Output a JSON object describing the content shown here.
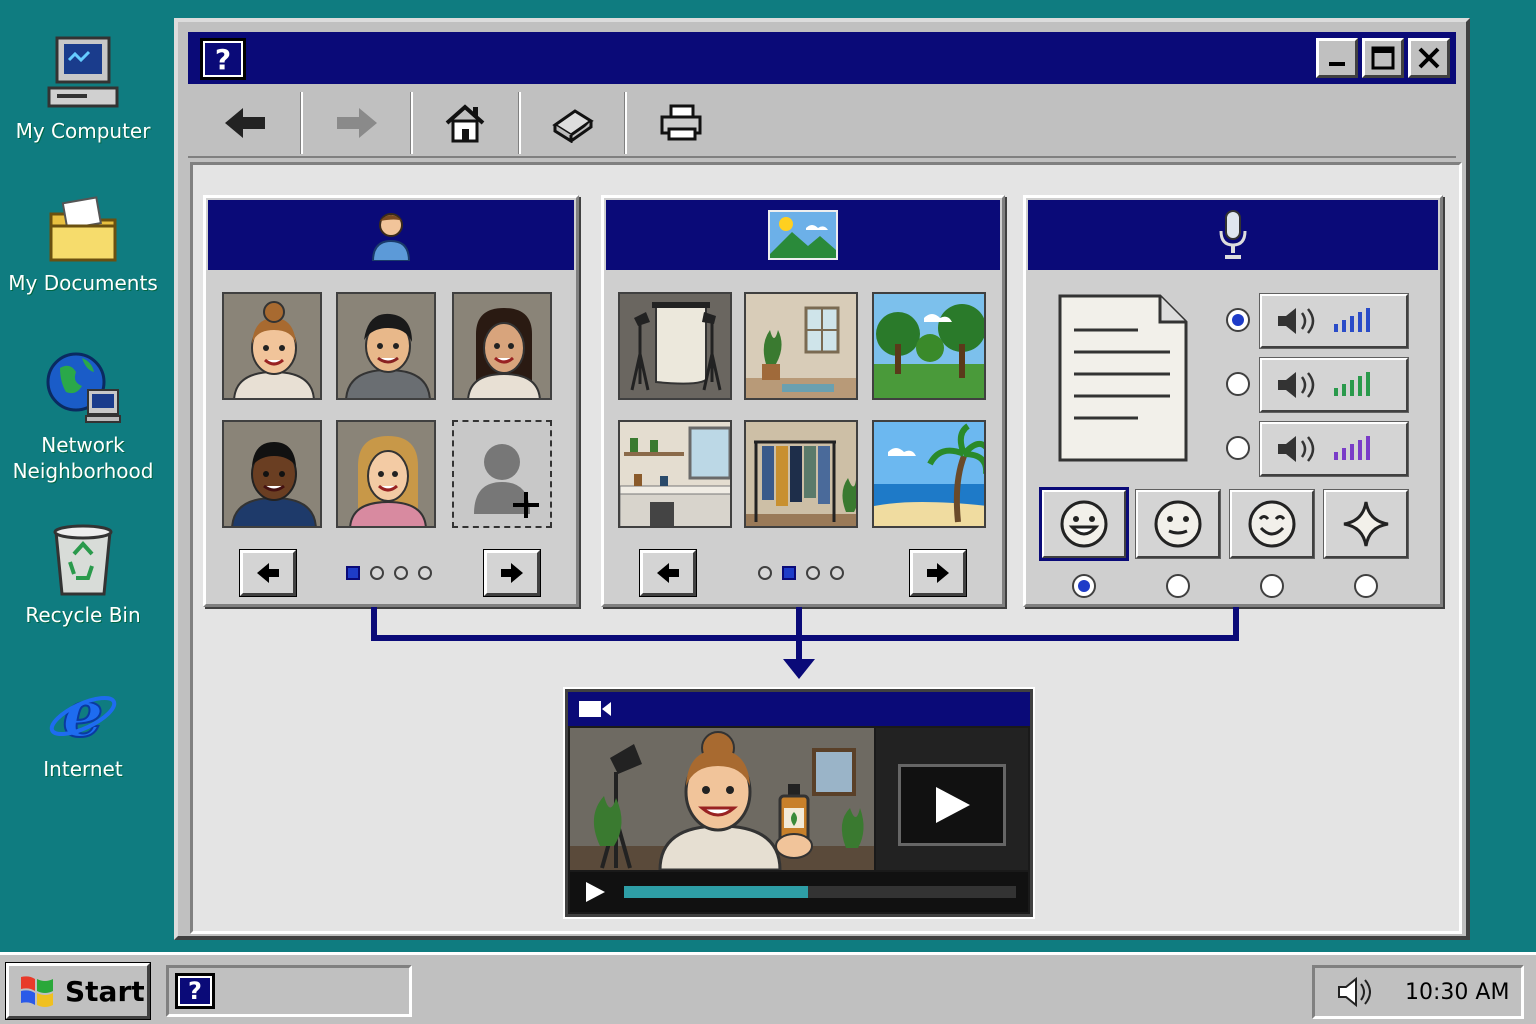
{
  "desktop": {
    "icons": [
      {
        "label": "My Computer",
        "icon": "computer-icon"
      },
      {
        "label": "My Documents",
        "icon": "folder-icon"
      },
      {
        "label": "Network Neighborhood",
        "icon": "network-icon"
      },
      {
        "label": "Recycle Bin",
        "icon": "recycle-bin-icon"
      },
      {
        "label": "Internet",
        "icon": "internet-explorer-icon"
      }
    ]
  },
  "window": {
    "title_icon": "help-icon",
    "help_glyph": "?",
    "toolbar": [
      "back-arrow-icon",
      "forward-arrow-icon",
      "home-icon",
      "book-icon",
      "printer-icon"
    ]
  },
  "avatars_panel": {
    "header_icon": "person-icon",
    "page_dots": 4,
    "active_dot": 1
  },
  "backgrounds_panel": {
    "header_icon": "landscape-icon",
    "page_dots": 4,
    "active_dot": 2
  },
  "voice_panel": {
    "header_icon": "microphone-icon",
    "voices": [
      {
        "selected": true,
        "bar_color": "#2a4cc8"
      },
      {
        "selected": false,
        "bar_color": "#2a9a4c"
      },
      {
        "selected": false,
        "bar_color": "#7a3cc8"
      }
    ],
    "emotions": [
      {
        "icon": "happy-face-icon",
        "selected": true
      },
      {
        "icon": "neutral-face-icon",
        "selected": false
      },
      {
        "icon": "smile-face-icon",
        "selected": false
      },
      {
        "icon": "sparkle-icon",
        "selected": false
      }
    ]
  },
  "video": {
    "header_icon": "video-camera-icon",
    "progress": 0.47
  },
  "taskbar": {
    "start_label": "Start",
    "task_icon": "help-icon",
    "help_glyph": "?",
    "clock": "10:30 AM"
  }
}
